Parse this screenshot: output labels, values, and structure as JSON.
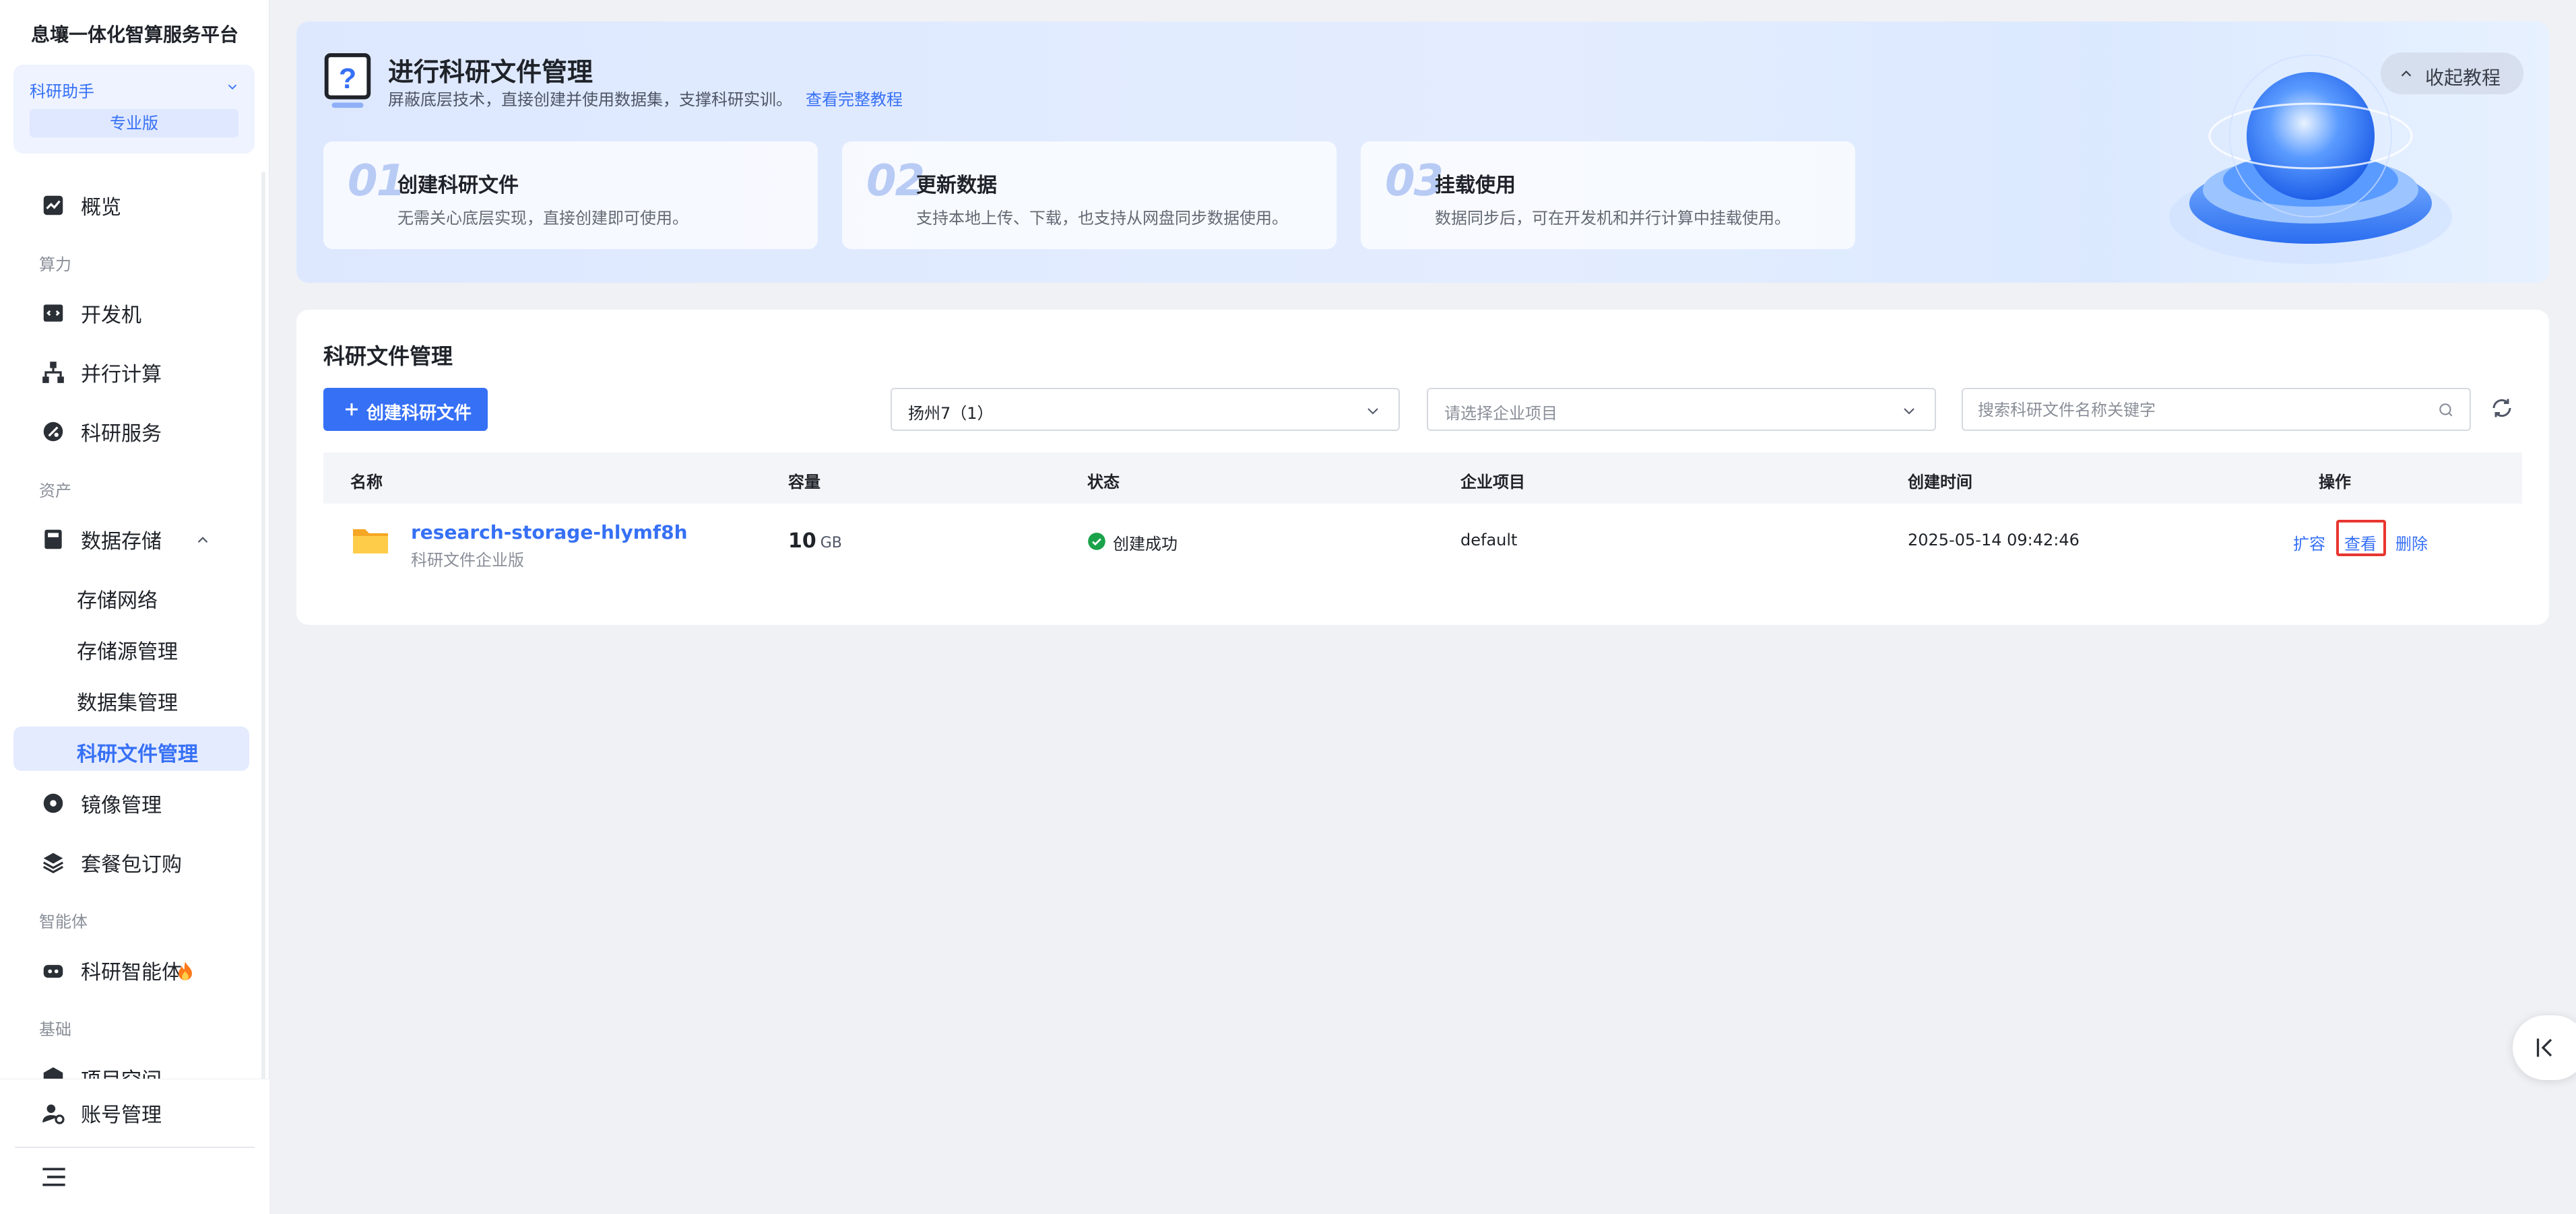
{
  "sidebar": {
    "brand": "息壤一体化智算服务平台",
    "assistant": {
      "name": "科研助手",
      "edition": "专业版"
    },
    "items": {
      "overview": "概览",
      "group_compute": "算力",
      "dev_machine": "开发机",
      "parallel": "并行计算",
      "research_service": "科研服务",
      "group_assets": "资产",
      "data_storage": "数据存储",
      "storage_network": "存储网络",
      "storage_source": "存储源管理",
      "dataset": "数据集管理",
      "research_files": "科研文件管理",
      "image_mgmt": "镜像管理",
      "package": "套餐包订购",
      "group_agent": "智能体",
      "research_agent": "科研智能体",
      "group_base": "基础",
      "project_space": "项目空间",
      "account": "账号管理"
    }
  },
  "banner": {
    "title": "进行科研文件管理",
    "desc": "屏蔽底层技术，直接创建并使用数据集，支撑科研实训。",
    "link": "查看完整教程",
    "collapse": "收起教程",
    "steps": [
      {
        "num": "01",
        "title": "创建科研文件",
        "desc": "无需关心底层实现，直接创建即可使用。"
      },
      {
        "num": "02",
        "title": "更新数据",
        "desc": "支持本地上传、下载，也支持从网盘同步数据使用。"
      },
      {
        "num": "03",
        "title": "挂载使用",
        "desc": "数据同步后，可在开发机和并行计算中挂载使用。"
      }
    ]
  },
  "panel": {
    "title": "科研文件管理",
    "create_label": "创建科研文件",
    "region_select": "扬州7（1）",
    "project_placeholder": "请选择企业项目",
    "search_placeholder": "搜索科研文件名称关键字",
    "columns": {
      "name": "名称",
      "capacity": "容量",
      "status": "状态",
      "project": "企业项目",
      "created": "创建时间",
      "actions": "操作"
    },
    "rows": [
      {
        "name": "research-storage-hlymf8h",
        "type": "科研文件企业版",
        "capacity": "10",
        "unit": "GB",
        "status": "创建成功",
        "project": "default",
        "created": "2025-05-14 09:42:46",
        "actions": {
          "expand": "扩容",
          "view": "查看",
          "delete": "删除"
        }
      }
    ]
  },
  "colors": {
    "accent": "#3670f5",
    "success": "#1aa34a",
    "highlight": "#e8362f"
  }
}
